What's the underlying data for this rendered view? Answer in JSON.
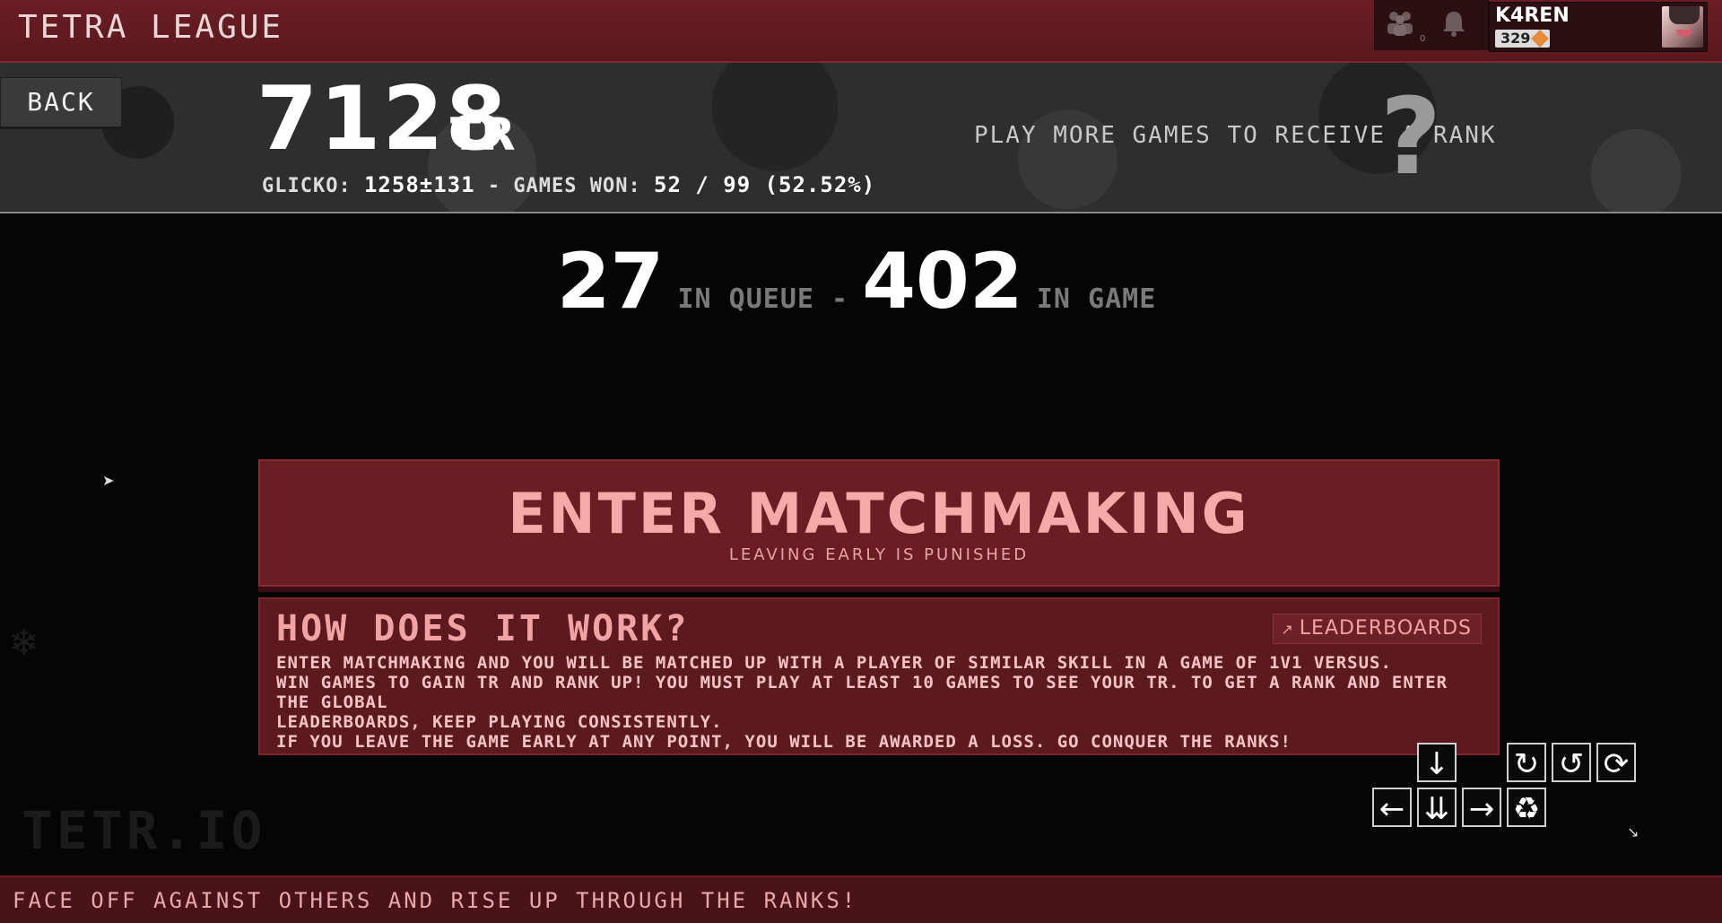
{
  "header": {
    "title": "TETRA LEAGUE",
    "friends_count": "0",
    "user": {
      "name": "K4REN",
      "level": "329"
    }
  },
  "hero": {
    "back_label": "BACK",
    "tr": "7128",
    "tr_unit": "TR",
    "glicko_label": "GLICKO:",
    "glicko_value": "1258±131",
    "sep": "-",
    "games_won_label": "GAMES WON:",
    "games_won_value": "52 / 99 (52.52%)",
    "rank_message": "PLAY MORE GAMES TO RECEIVE A RANK",
    "rank_icon": "?"
  },
  "queue": {
    "in_queue_count": "27",
    "in_queue_label": "IN QUEUE -",
    "in_game_count": "402",
    "in_game_label": "IN GAME"
  },
  "matchmaking": {
    "title": "ENTER MATCHMAKING",
    "subtitle": "LEAVING EARLY IS PUNISHED"
  },
  "info": {
    "heading": "HOW DOES IT WORK?",
    "leaderboards_label": "LEADERBOARDS",
    "lines": [
      "ENTER MATCHMAKING AND YOU WILL BE MATCHED UP WITH A PLAYER OF SIMILAR SKILL IN A GAME OF 1V1 VERSUS.",
      "WIN GAMES TO GAIN TR AND RANK UP! YOU MUST PLAY AT LEAST 10 GAMES TO SEE YOUR TR. TO GET A RANK AND ENTER THE GLOBAL",
      "LEADERBOARDS, KEEP PLAYING CONSISTENTLY.",
      "IF YOU LEAVE THE GAME EARLY AT ANY POINT, YOU WILL BE AWARDED A LOSS. GO CONQUER THE RANKS!"
    ]
  },
  "keys": {
    "soft_drop": "↓",
    "rotate_cw": "↻",
    "rotate_ccw": "↺",
    "rotate_180": "⟳",
    "move_left": "←",
    "hard_drop": "⇊",
    "move_right": "→",
    "hold": "♻"
  },
  "watermark": "TETR.IO",
  "footer": {
    "text": "FACE OFF AGAINST OTHERS AND RISE UP THROUGH THE RANKS!"
  },
  "colors": {
    "accent_red": "#6a1e24",
    "accent_pink": "#f5a9a9"
  }
}
